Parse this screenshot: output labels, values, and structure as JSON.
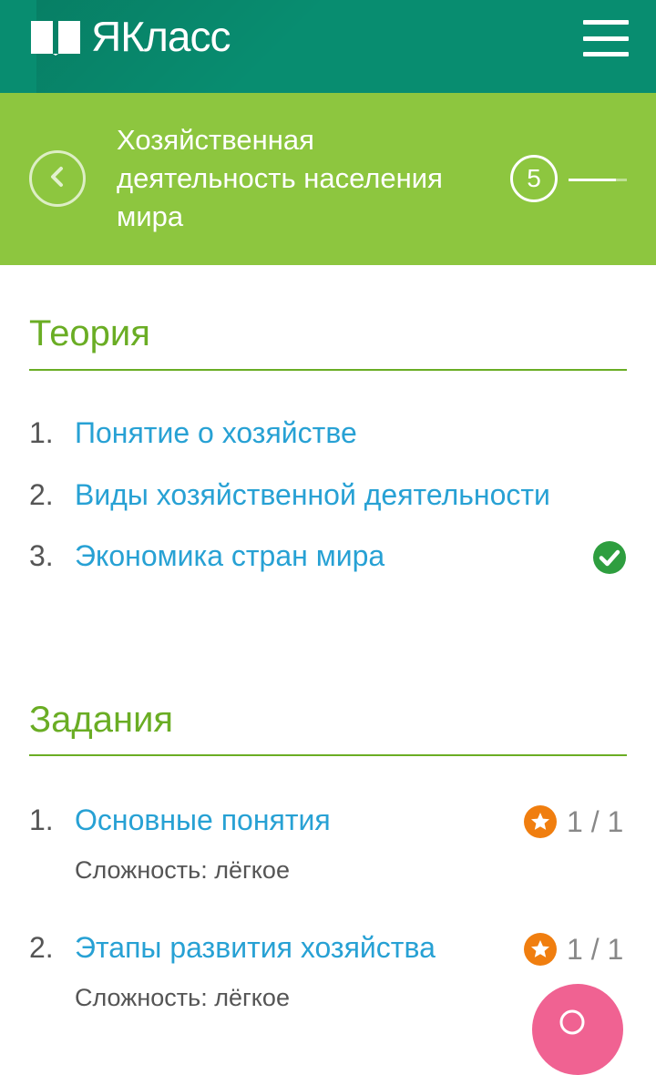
{
  "header": {
    "logo_text": "ЯКласс",
    "logo_icon": "open-book-icon",
    "menu_icon": "hamburger-icon"
  },
  "lesson": {
    "title": "Хозяйственная деятельность населения мира",
    "back_icon": "chevron-left-icon",
    "grade": "5"
  },
  "theory": {
    "title": "Теория",
    "items": [
      {
        "num": "1.",
        "label": "Понятие о хозяйстве",
        "completed": false
      },
      {
        "num": "2.",
        "label": "Виды хозяйственной деятельности",
        "completed": false
      },
      {
        "num": "3.",
        "label": "Экономика стран мира",
        "completed": true
      }
    ]
  },
  "tasks": {
    "title": "Задания",
    "items": [
      {
        "num": "1.",
        "label": "Основные понятия",
        "difficulty": "Сложность: лёгкое",
        "score": "1 / 1"
      },
      {
        "num": "2.",
        "label": "Этапы развития хозяйства",
        "difficulty": "Сложность: лёгкое",
        "score": "1 / 1"
      }
    ]
  },
  "colors": {
    "header_bg": "#088d70",
    "lesson_bg": "#8dc63f",
    "section_green": "#6aad24",
    "link_blue": "#27a1d4",
    "check_green": "#2e9e3f",
    "star_orange": "#f07e0f",
    "fab_pink": "#f06292"
  }
}
